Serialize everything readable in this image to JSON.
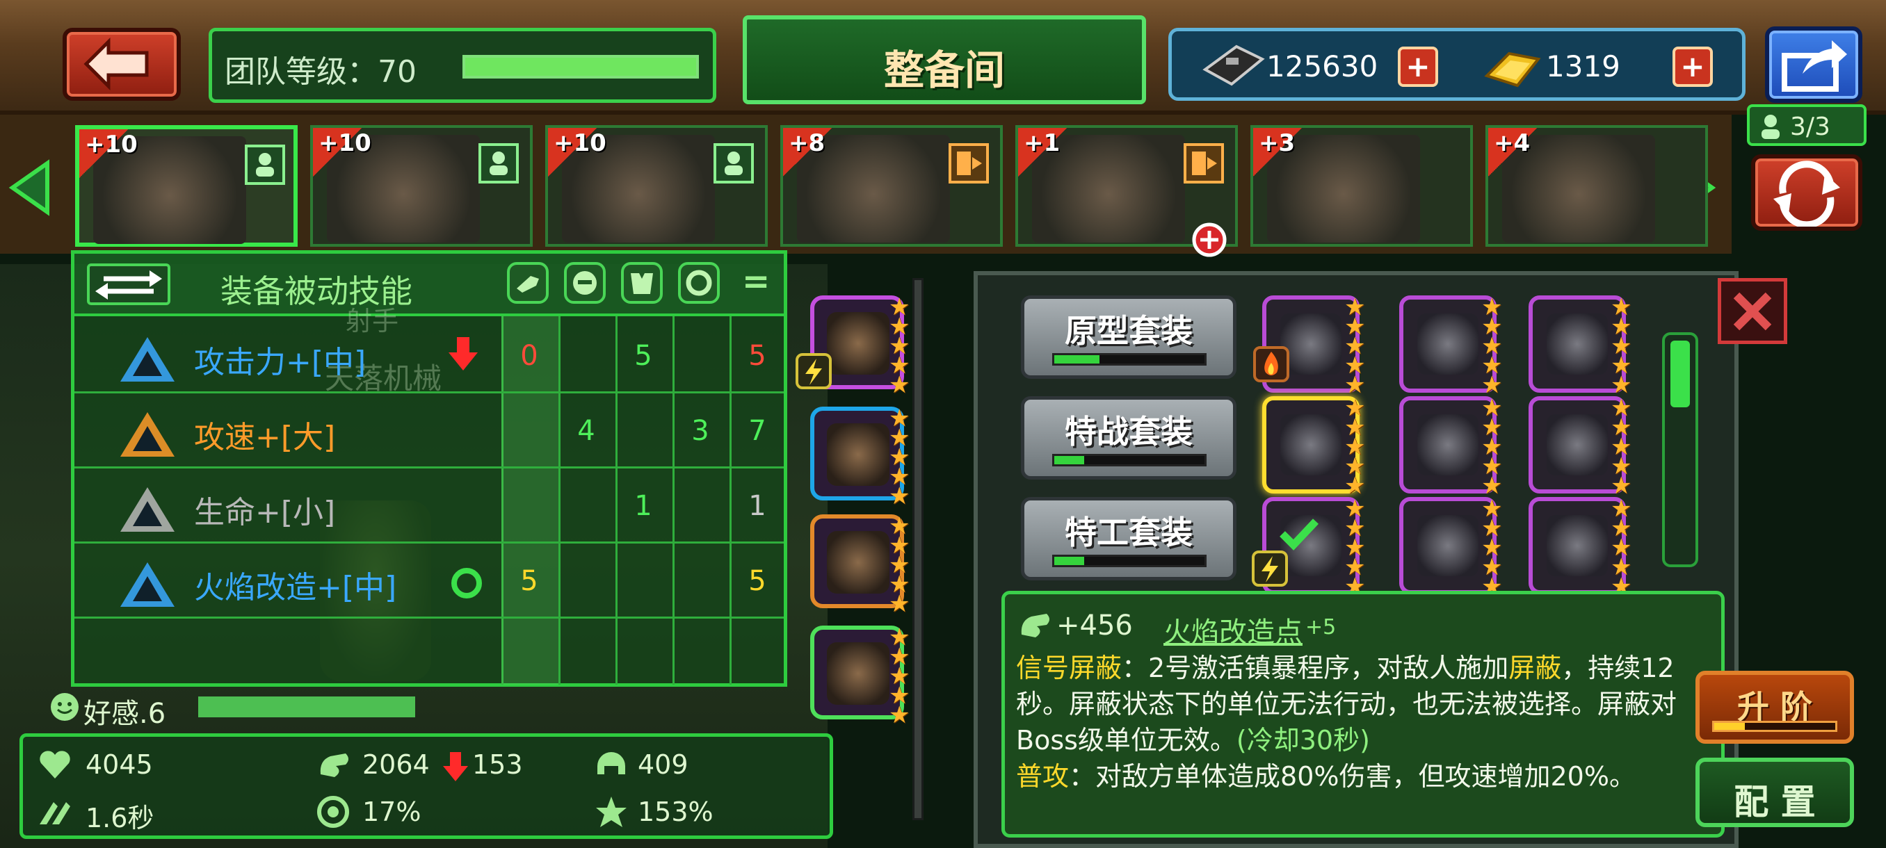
{
  "header": {
    "team_level_label": "团队等级：70",
    "team_level_progress": 1.0,
    "title": "整备间",
    "currency1_value": "125630",
    "currency2_value": "1319",
    "plus_symbol": "+"
  },
  "heroes": {
    "count": "3/3",
    "items": [
      {
        "level": "+10",
        "role": "person",
        "selected": true
      },
      {
        "level": "+10",
        "role": "person",
        "selected": false
      },
      {
        "level": "+10",
        "role": "person",
        "selected": false
      },
      {
        "level": "+8",
        "role": "switch",
        "selected": false
      },
      {
        "level": "+1",
        "role": "switch",
        "selected": false
      },
      {
        "level": "+3",
        "role": "none",
        "selected": false
      },
      {
        "level": "+4",
        "role": "none",
        "selected": false
      }
    ]
  },
  "passive_table": {
    "title": "装备被动技能",
    "totals_symbol": "=",
    "background_labels": [
      "射手",
      "天落机械"
    ],
    "rows": [
      {
        "name": "攻击力+[中]",
        "color": "#3aa8ff",
        "arrow": "down",
        "c1": "0",
        "c2": "",
        "c3": "5",
        "c4": "",
        "total": "5",
        "c1_color": "#ff4b3a",
        "total_color": "#ff4b3a"
      },
      {
        "name": "攻速+[大]",
        "color": "#ff9b2a",
        "arrow": "",
        "c1": "",
        "c2": "4",
        "c3": "",
        "c4": "3",
        "total": "7",
        "c1_color": "#4ef05a",
        "total_color": "#4ef05a"
      },
      {
        "name": "生命+[小]",
        "color": "#b8b8b8",
        "arrow": "",
        "c1": "",
        "c2": "",
        "c3": "1",
        "c4": "",
        "total": "1",
        "c1_color": "#4ef05a",
        "total_color": "#c9c9c9"
      },
      {
        "name": "火焰改造+[中]",
        "color": "#3aa8ff",
        "arrow": "ring",
        "c1": "5",
        "c2": "",
        "c3": "",
        "c4": "",
        "total": "5",
        "c1_color": "#ffd92b",
        "total_color": "#ffd92b"
      }
    ]
  },
  "affection": {
    "label": "好感.6",
    "progress": 1.0
  },
  "stats": {
    "hp": "4045",
    "attack": "2064",
    "attack_delta": "153",
    "defense": "409",
    "attack_speed": "1.6秒",
    "crit": "17%",
    "crit_damage": "153%"
  },
  "equipment_slots": [
    {
      "border": "#c44fe0",
      "stars": 5
    },
    {
      "border": "#1ea6e8",
      "stars": 5
    },
    {
      "border": "#e3892a",
      "stars": 5
    },
    {
      "border": "#4ee05a",
      "stars": 5
    }
  ],
  "sets": [
    {
      "label": "原型套装",
      "progress": 0.3
    },
    {
      "label": "特战套装",
      "progress": 0.2
    },
    {
      "label": "特工套装",
      "progress": 0.2
    }
  ],
  "description": {
    "power": "+456",
    "skill_link": "火焰改造点",
    "skill_bonus": "+5",
    "line_a_title": "信号屏蔽",
    "line_a_text1": "：2号激活镇暴程序，对敌人施加",
    "line_a_key": "屏蔽",
    "line_a_text2": "，持续12秒。屏蔽状态下的单位无法行动，也无法被选择。屏蔽对Boss级单位无效。",
    "line_a_cooldown": "(冷却30秒)",
    "line_b_title": "普攻",
    "line_b_text": "：对敌方单体造成80%伤害，但攻速增加20%。"
  },
  "buttons": {
    "upgrade": "升 阶",
    "upgrade_progress": 0.25,
    "config": "配 置"
  }
}
